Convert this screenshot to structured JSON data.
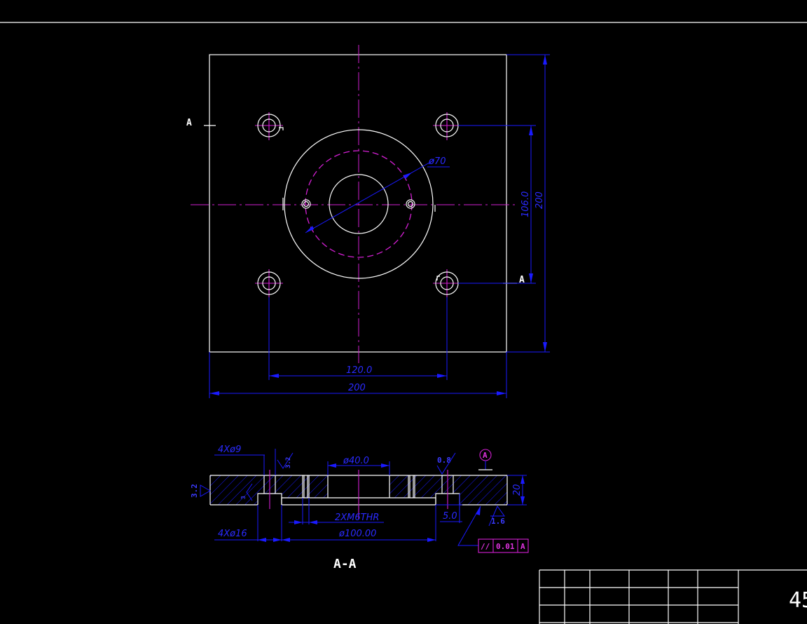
{
  "plan_view": {
    "dim_width_total": "200",
    "dim_hole_spacing_x": "120.0",
    "dim_height_total": "200",
    "dim_hole_spacing_y": "106.0",
    "dim_circle_diameter": "ø70",
    "section_mark_left": "A",
    "section_mark_right": "A"
  },
  "section_view": {
    "title": "A-A",
    "callout_holes_top": "4Xø9",
    "callout_holes_bottom": "4Xø16",
    "callout_bore": "ø40.0",
    "callout_recess": "ø100.00",
    "callout_thread": "2XM6THR",
    "dim_thickness": "20",
    "dim_depth": "5.0",
    "roughness_left": "3.2",
    "roughness_left_small": "3",
    "roughness_top": "3.2",
    "roughness_right_top": "0.8",
    "roughness_bottom": "1.6",
    "datum": "A",
    "tolerance_symbol": "//",
    "tolerance_value": "0.01",
    "tolerance_datum": "A"
  },
  "title_block": {
    "material": "45"
  }
}
